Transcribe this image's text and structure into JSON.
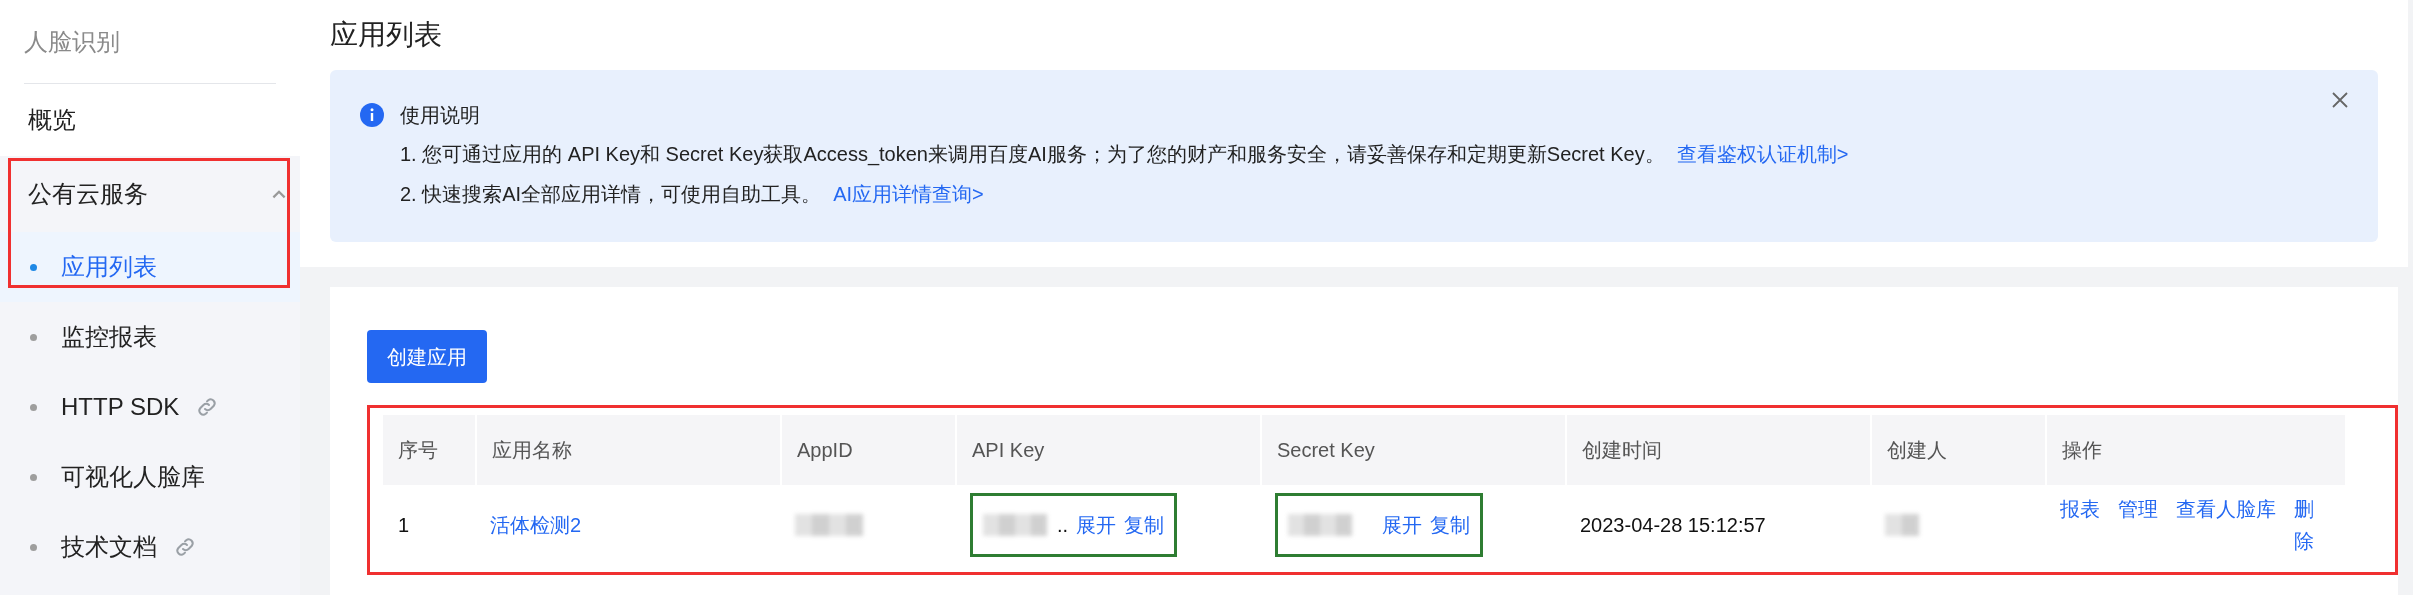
{
  "sidebar": {
    "title": "人脸识别",
    "overview": "概览",
    "group": {
      "label": "公有云服务",
      "expanded": true,
      "outlined": true,
      "children": [
        {
          "label": "应用列表",
          "selected": true,
          "external": false
        },
        {
          "label": "监控报表",
          "selected": false,
          "external": false
        },
        {
          "label": "HTTP SDK",
          "selected": false,
          "external": true
        },
        {
          "label": "可视化人脸库",
          "selected": false,
          "external": false
        },
        {
          "label": "技术文档",
          "selected": false,
          "external": true
        }
      ]
    }
  },
  "page_title": "应用列表",
  "notice": {
    "title": "使用说明",
    "lines": [
      {
        "text": "1. 您可通过应用的 API Key和 Secret Key获取Access_token来调用百度AI服务；为了您的财产和服务安全，请妥善保存和定期更新Secret Key。",
        "link": "查看鉴权认证机制>"
      },
      {
        "text": "2. 快速搜索AI全部应用详情，可使用自助工具。",
        "link": "AI应用详情查询>"
      }
    ]
  },
  "create_button": "创建应用",
  "table": {
    "outlined": true,
    "columns": [
      "序号",
      "应用名称",
      "AppID",
      "API Key",
      "Secret Key",
      "创建时间",
      "创建人",
      "操作"
    ],
    "rows": [
      {
        "cells": [
          {
            "kind": "text",
            "text": "1"
          },
          {
            "kind": "link",
            "text": "活体检测2"
          },
          {
            "kind": "hidden"
          },
          {
            "kind": "key",
            "ellipsis": "..",
            "actions": [
              "展开",
              "复制"
            ],
            "outlined": true
          },
          {
            "kind": "key",
            "actions": [
              "展开",
              "复制"
            ],
            "outlined": true
          },
          {
            "kind": "text",
            "text": "2023-04-28 15:12:57"
          },
          {
            "kind": "hidden"
          },
          {
            "kind": "actions",
            "actions": [
              "报表",
              "管理",
              "查看人脸库",
              "删除"
            ]
          }
        ]
      }
    ]
  }
}
